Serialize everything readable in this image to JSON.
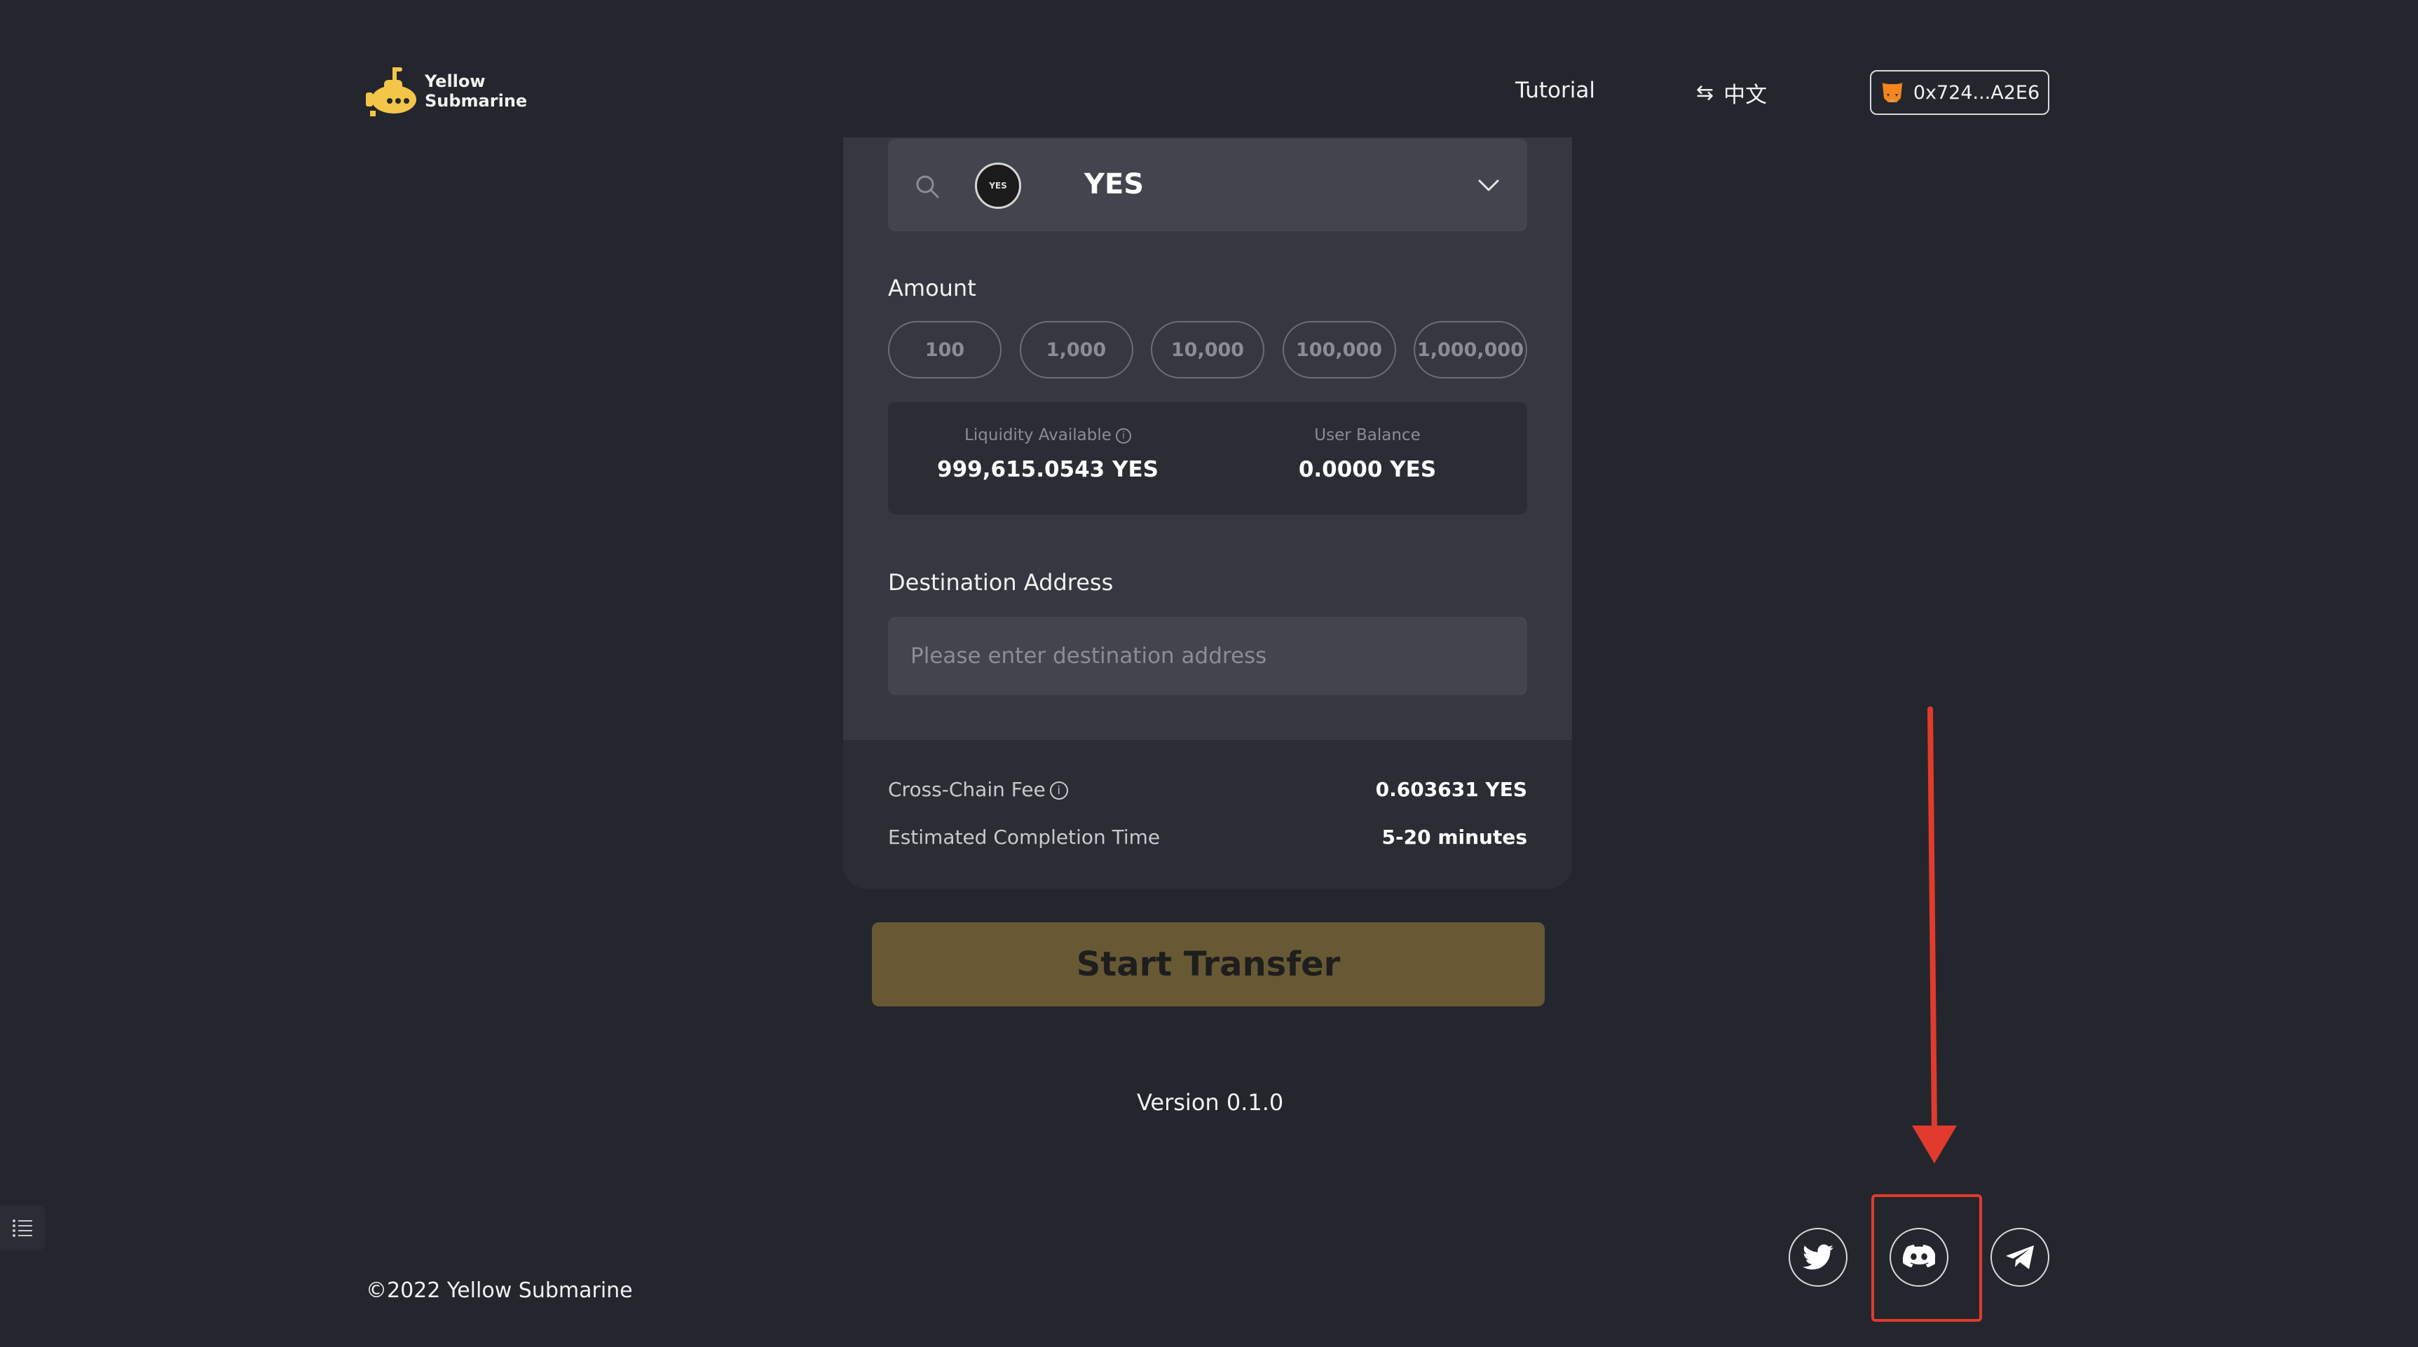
{
  "header": {
    "logo_line1": "Yellow",
    "logo_line2": "Submarine",
    "tutorial": "Tutorial",
    "lang_label": "中文",
    "wallet_address": "0x724...A2E6"
  },
  "token_select": {
    "token_symbol": "YES",
    "token_logo_text": "YES"
  },
  "amount": {
    "label": "Amount",
    "presets": [
      "100",
      "1,000",
      "10,000",
      "100,000",
      "1,000,000"
    ]
  },
  "stats": {
    "liquidity_label": "Liquidity Available",
    "liquidity_value": "999,615.0543 YES",
    "balance_label": "User Balance",
    "balance_value": "0.0000 YES"
  },
  "destination": {
    "label": "Destination Address",
    "placeholder": "Please enter destination address",
    "value": ""
  },
  "fees": {
    "fee_label": "Cross-Chain Fee",
    "fee_value": "0.603631 YES",
    "time_label": "Estimated Completion Time",
    "time_value": "5-20 minutes"
  },
  "start_button": "Start Transfer",
  "version": "Version 0.1.0",
  "footer": {
    "copyright": "©2022 Yellow Submarine"
  },
  "social_icons": [
    "twitter-icon",
    "discord-icon",
    "telegram-icon"
  ],
  "colors": {
    "background": "#24262d",
    "card": "#353840",
    "accent_button": "#675934",
    "brand_yellow": "#f3c64a",
    "highlight": "#e03b2c"
  }
}
